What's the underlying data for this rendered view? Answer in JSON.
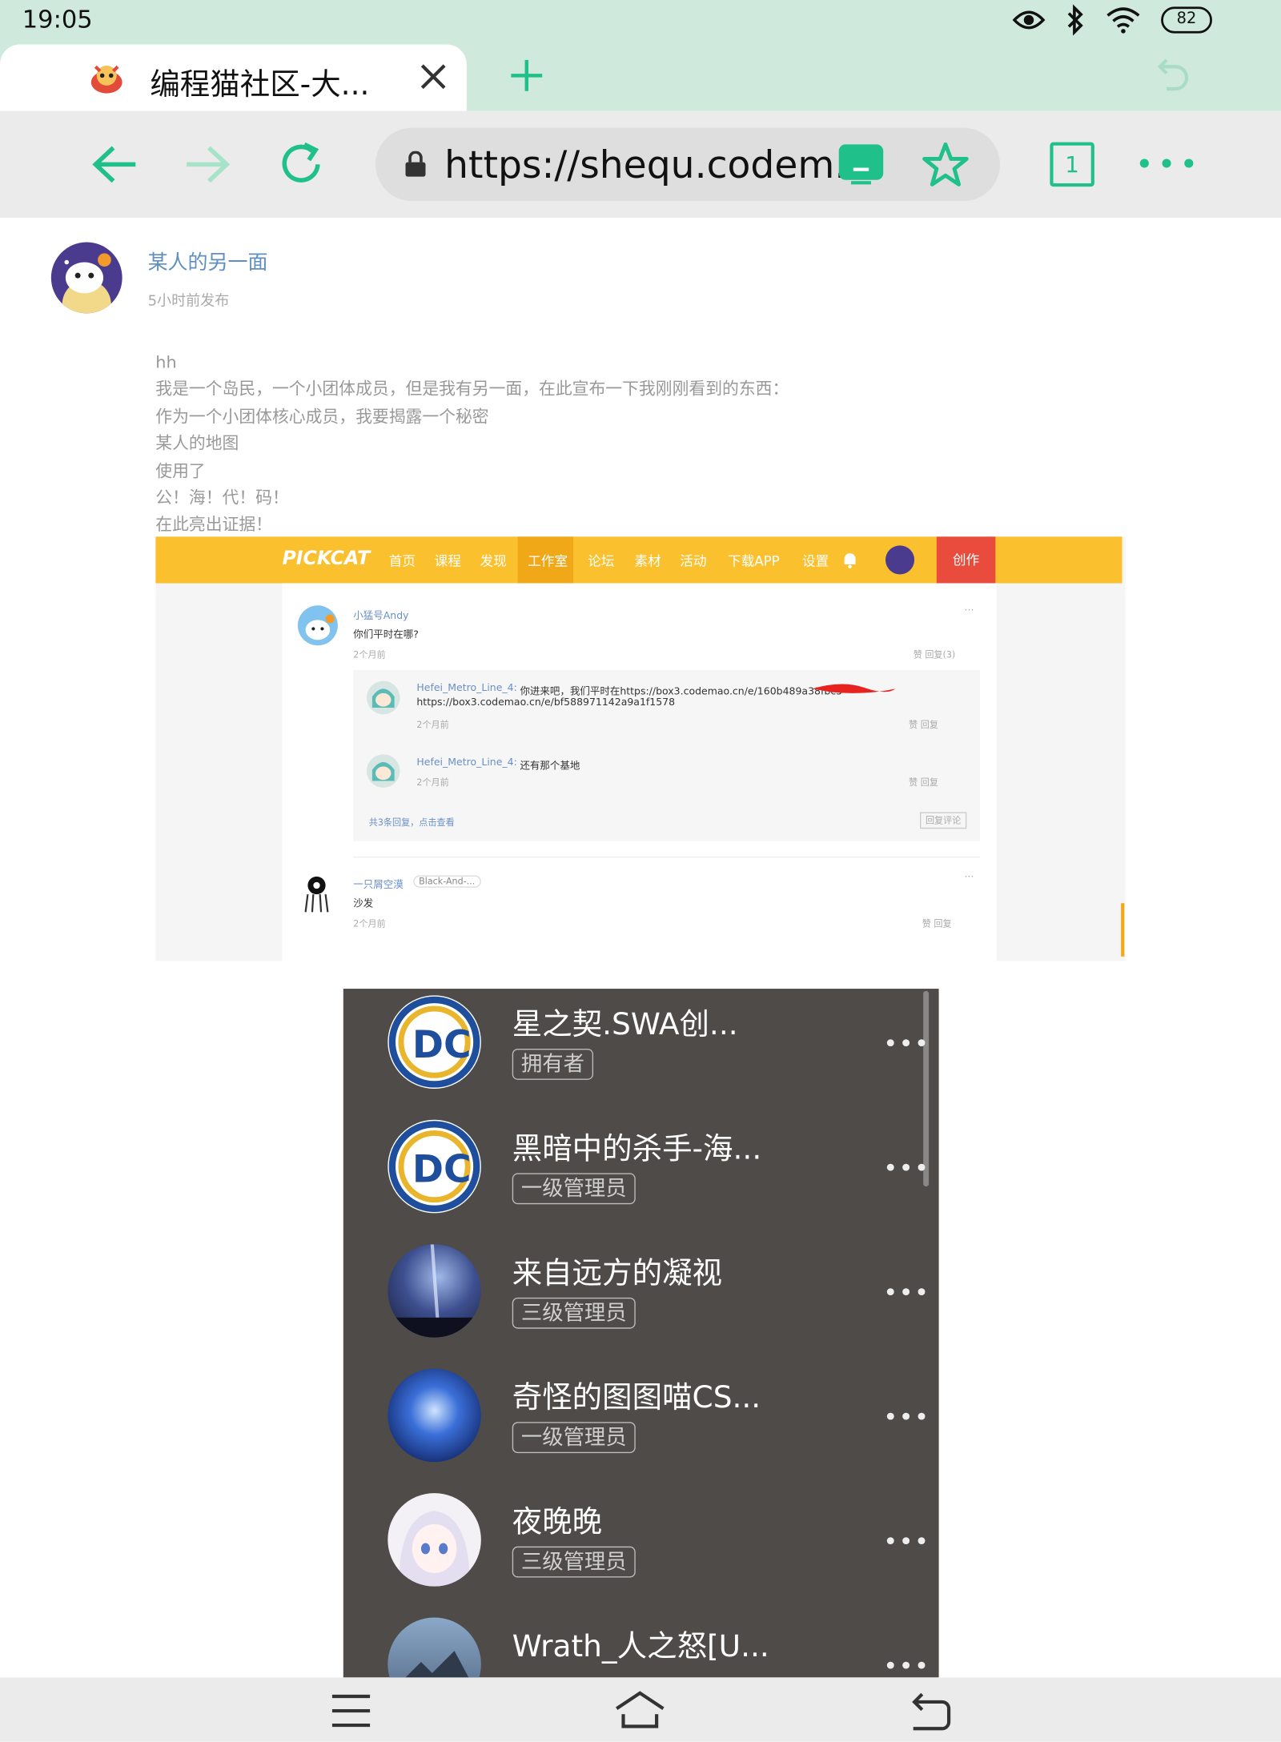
{
  "status_bar": {
    "time": "19:05",
    "battery": "82"
  },
  "tab": {
    "title": "编程猫社区-大..."
  },
  "address": {
    "url": "https://shequ.codem..."
  },
  "tab_count": "1",
  "post": {
    "author": "某人的另一面",
    "time": "5小时前发布",
    "lines": [
      "hh",
      "我是一个岛民，一个小团体成员，但是我有另一面，在此宣布一下我刚刚看到的东西：",
      "作为一个小团体核心成员，我要揭露一个秘密",
      "某人的地图",
      "使用了",
      "公！海！代！码！",
      "在此亮出证据！"
    ]
  },
  "screenshot1": {
    "logo": "PICKCAT",
    "nav": [
      "首页",
      "课程",
      "发现",
      "工作室",
      "论坛",
      "素材",
      "活动",
      "下载APP",
      "设置"
    ],
    "create": "创作",
    "comment1": {
      "user": "小猛号Andy",
      "text": "你们平时在哪?",
      "time": "2个月前",
      "actions": "赞  回复(3)",
      "dots": "···"
    },
    "reply1": {
      "user": "Hefei_Metro_Line_4:",
      "text": "你进来吧，我们平时在https://box3.codemao.cn/e/160b489a38fbc5",
      "text2": "https://box3.codemao.cn/e/bf588971142a9a1f1578",
      "time": "2个月前",
      "actions": "赞  回复"
    },
    "reply2": {
      "user": "Hefei_Metro_Line_4:",
      "text": "还有那个基地",
      "time": "2个月前",
      "actions": "赞  回复"
    },
    "more_replies": "共3条回复，点击查看",
    "reply_btn": "回复评论",
    "comment2": {
      "user": "一只屑空漠",
      "badge": "Black-And-...",
      "text": "沙发",
      "time": "2个月前",
      "actions": "赞  回复"
    }
  },
  "screenshot2": {
    "members": [
      {
        "name": "星之契.SWA创...",
        "role": "拥有者"
      },
      {
        "name": "黑暗中的杀手-海...",
        "role": "一级管理员"
      },
      {
        "name": "来自远方的凝视",
        "role": "三级管理员"
      },
      {
        "name": "奇怪的图图喵CS...",
        "role": "一级管理员"
      },
      {
        "name": "夜晚晚",
        "role": "三级管理员"
      },
      {
        "name": "Wrath_人之怒[U...",
        "role": ""
      }
    ],
    "dots": "•••"
  },
  "colors": {
    "accent": "#1fc08a",
    "status_bg": "#cfeadc",
    "pickcat_yellow": "#fbc02d",
    "create_red": "#e94b3c"
  }
}
